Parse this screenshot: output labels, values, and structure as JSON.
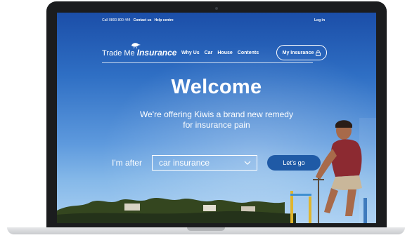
{
  "top_bar": {
    "phone": "Call 0800 800 444",
    "contact": "Contact us",
    "help": "Help centre",
    "login": "Log in"
  },
  "logo": {
    "prefix": "Trade Me",
    "brand": "Insurance",
    "icon": "kiwi-bird-icon"
  },
  "nav": {
    "items": [
      "Why Us",
      "Car",
      "House",
      "Contents"
    ],
    "my_insurance": "My Insurance",
    "my_insurance_icon": "lock-icon"
  },
  "hero": {
    "title": "Welcome",
    "subtitle_line1": "We're offering Kiwis a brand new remedy",
    "subtitle_line2": "for insurance pain"
  },
  "search": {
    "label": "I'm after",
    "selected": "car insurance",
    "button": "Let's go"
  },
  "colors": {
    "sky_top": "#1b4ea8",
    "sky_bottom": "#a9cff2",
    "button": "#1f5aa6",
    "laptop_bezel": "#1b1c1e"
  }
}
